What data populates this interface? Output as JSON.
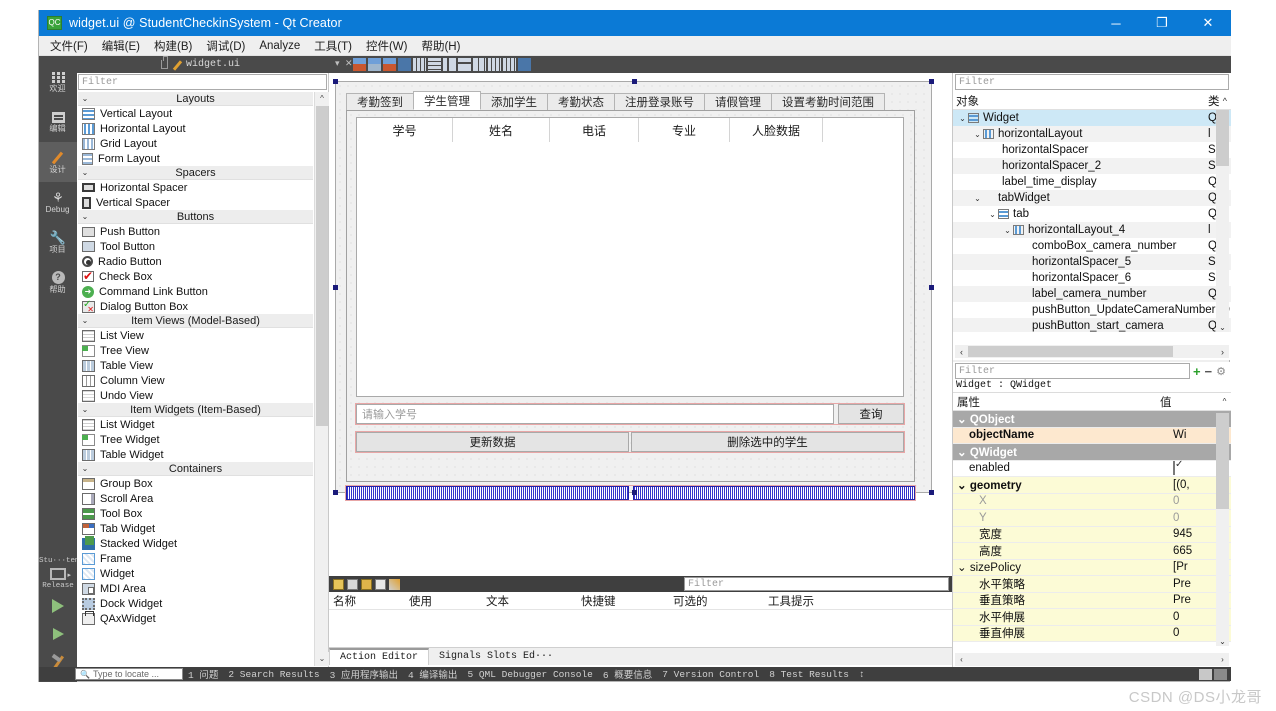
{
  "window": {
    "title": "widget.ui @ StudentCheckinSystem - Qt Creator",
    "app_icon": "qt-creator-icon",
    "minimize": "─",
    "maximize": "❐",
    "close": "✕"
  },
  "menubar": [
    {
      "label": "文件(F)"
    },
    {
      "label": "编辑(E)"
    },
    {
      "label": "构建(B)"
    },
    {
      "label": "调试(D)"
    },
    {
      "label": "Analyze"
    },
    {
      "label": "工具(T)"
    },
    {
      "label": "控件(W)"
    },
    {
      "label": "帮助(H)"
    }
  ],
  "modebar": {
    "items": [
      {
        "label": "欢迎",
        "icon": "grid-icon",
        "active": false
      },
      {
        "label": "编辑",
        "icon": "edit-icon",
        "active": false
      },
      {
        "label": "设计",
        "icon": "design-pencil-icon",
        "active": true
      },
      {
        "label": "Debug",
        "icon": "bug-icon",
        "active": false
      },
      {
        "label": "项目",
        "icon": "wrench-icon",
        "active": false
      },
      {
        "label": "帮助",
        "icon": "help-icon",
        "active": false
      }
    ],
    "kit_name": "Stu···tem",
    "kit_config": "Release",
    "run_icon": "run-icon",
    "debug_icon": "debug-run-icon",
    "build_icon": "build-hammer-icon"
  },
  "editor_toolbar": {
    "filename": "widget.ui",
    "lock_icon": "lock-icon",
    "file_icon": "ui-file-icon",
    "dropdown_icon": "chevron-down-icon",
    "close_icon": "close-icon",
    "form_tools": [
      "adjust-size-icon",
      "break-layout-icon",
      "lay-out-icon",
      "preview-icon",
      "lay-out-horizontally-icon",
      "lay-out-vertically-icon",
      "lay-out-splitter-h-icon",
      "lay-out-splitter-v-icon",
      "lay-out-form-icon",
      "lay-out-grid-icon",
      "signals-slots-icon",
      "buddy-editor-icon"
    ]
  },
  "widget_box": {
    "filter_placeholder": "Filter",
    "groups": [
      {
        "title": "Layouts",
        "items": [
          {
            "label": "Vertical Layout",
            "icon": "vertical-layout-icon"
          },
          {
            "label": "Horizontal Layout",
            "icon": "horizontal-layout-icon"
          },
          {
            "label": "Grid Layout",
            "icon": "grid-layout-icon"
          },
          {
            "label": "Form Layout",
            "icon": "form-layout-icon"
          }
        ]
      },
      {
        "title": "Spacers",
        "items": [
          {
            "label": "Horizontal Spacer",
            "icon": "horizontal-spacer-icon"
          },
          {
            "label": "Vertical Spacer",
            "icon": "vertical-spacer-icon"
          }
        ]
      },
      {
        "title": "Buttons",
        "items": [
          {
            "label": "Push Button",
            "icon": "push-button-icon"
          },
          {
            "label": "Tool Button",
            "icon": "tool-button-icon"
          },
          {
            "label": "Radio Button",
            "icon": "radio-button-icon"
          },
          {
            "label": "Check Box",
            "icon": "check-box-icon"
          },
          {
            "label": "Command Link Button",
            "icon": "command-link-button-icon"
          },
          {
            "label": "Dialog Button Box",
            "icon": "dialog-button-box-icon"
          }
        ]
      },
      {
        "title": "Item Views (Model-Based)",
        "items": [
          {
            "label": "List View",
            "icon": "list-view-icon"
          },
          {
            "label": "Tree View",
            "icon": "tree-view-icon"
          },
          {
            "label": "Table View",
            "icon": "table-view-icon"
          },
          {
            "label": "Column View",
            "icon": "column-view-icon"
          },
          {
            "label": "Undo View",
            "icon": "undo-view-icon"
          }
        ]
      },
      {
        "title": "Item Widgets (Item-Based)",
        "items": [
          {
            "label": "List Widget",
            "icon": "list-widget-icon"
          },
          {
            "label": "Tree Widget",
            "icon": "tree-widget-icon"
          },
          {
            "label": "Table Widget",
            "icon": "table-widget-icon"
          }
        ]
      },
      {
        "title": "Containers",
        "items": [
          {
            "label": "Group Box",
            "icon": "group-box-icon"
          },
          {
            "label": "Scroll Area",
            "icon": "scroll-area-icon"
          },
          {
            "label": "Tool Box",
            "icon": "tool-box-icon"
          },
          {
            "label": "Tab Widget",
            "icon": "tab-widget-icon"
          },
          {
            "label": "Stacked Widget",
            "icon": "stacked-widget-icon"
          },
          {
            "label": "Frame",
            "icon": "frame-icon"
          },
          {
            "label": "Widget",
            "icon": "widget-icon"
          },
          {
            "label": "MDI Area",
            "icon": "mdi-area-icon"
          },
          {
            "label": "Dock Widget",
            "icon": "dock-widget-icon"
          },
          {
            "label": "QAxWidget",
            "icon": "qaxwidget-icon"
          }
        ]
      }
    ]
  },
  "canvas": {
    "tabs": [
      {
        "label": "考勤签到",
        "selected": false
      },
      {
        "label": "学生管理",
        "selected": true
      },
      {
        "label": "添加学生",
        "selected": false
      },
      {
        "label": "考勤状态",
        "selected": false
      },
      {
        "label": "注册登录账号",
        "selected": false
      },
      {
        "label": "请假管理",
        "selected": false
      },
      {
        "label": "设置考勤时间范围",
        "selected": false
      }
    ],
    "table_headers": [
      "学号",
      "姓名",
      "电话",
      "专业",
      "人脸数据",
      ""
    ],
    "search_placeholder": "请输入学号",
    "search_button": "查询",
    "update_button": "更新数据",
    "delete_button": "删除选中的学生"
  },
  "action_editor": {
    "filter_placeholder": "Filter",
    "toolbar_icons": [
      "new-action-icon",
      "copy-icon",
      "paste-icon",
      "delete-icon",
      "edit-icon"
    ],
    "headers": [
      "名称",
      "使用",
      "文本",
      "快捷键",
      "可选的",
      "工具提示"
    ],
    "tabs": [
      {
        "label": "Action Editor",
        "selected": true
      },
      {
        "label": "Signals Slots Ed···",
        "selected": false
      }
    ]
  },
  "object_inspector": {
    "filter_placeholder": "Filter",
    "header_name": "对象",
    "header_class": "类",
    "rows": [
      {
        "name": "Widget",
        "cls": "Q",
        "indent": 0,
        "expander": "⌄",
        "icon": "widget-tree-icon",
        "selected": true
      },
      {
        "name": "horizontalLayout",
        "cls": "l",
        "indent": 1,
        "expander": "⌄",
        "icon": "hlayout-tree-icon",
        "selected": false
      },
      {
        "name": "horizontalSpacer",
        "cls": "S",
        "indent": 2,
        "expander": "",
        "icon": "",
        "selected": false
      },
      {
        "name": "horizontalSpacer_2",
        "cls": "S",
        "indent": 2,
        "expander": "",
        "icon": "",
        "selected": false
      },
      {
        "name": "label_time_display",
        "cls": "Q",
        "indent": 2,
        "expander": "",
        "icon": "",
        "selected": false
      },
      {
        "name": "tabWidget",
        "cls": "Q",
        "indent": 1,
        "expander": "⌄",
        "icon": "",
        "selected": false
      },
      {
        "name": "tab",
        "cls": "Q",
        "indent": 2,
        "expander": "⌄",
        "icon": "widget-tree-icon",
        "selected": false
      },
      {
        "name": "horizontalLayout_4",
        "cls": "l",
        "indent": 3,
        "expander": "⌄",
        "icon": "hlayout-tree-icon",
        "selected": false
      },
      {
        "name": "comboBox_camera_number",
        "cls": "Q",
        "indent": 4,
        "expander": "",
        "icon": "",
        "selected": false
      },
      {
        "name": "horizontalSpacer_5",
        "cls": "S",
        "indent": 4,
        "expander": "",
        "icon": "",
        "selected": false
      },
      {
        "name": "horizontalSpacer_6",
        "cls": "S",
        "indent": 4,
        "expander": "",
        "icon": "",
        "selected": false
      },
      {
        "name": "label_camera_number",
        "cls": "Q",
        "indent": 4,
        "expander": "",
        "icon": "",
        "selected": false
      },
      {
        "name": "pushButton_UpdateCameraNumber",
        "cls": "Q",
        "indent": 4,
        "expander": "",
        "icon": "",
        "selected": false
      },
      {
        "name": "pushButton_start_camera",
        "cls": "Q",
        "indent": 4,
        "expander": "",
        "icon": "",
        "selected": false
      }
    ]
  },
  "property_editor": {
    "filter_placeholder": "Filter",
    "tool_add": "+",
    "tool_remove": "−",
    "tool_config": "configure-icon",
    "object_line": "Widget : QWidget",
    "header_property": "属性",
    "header_value": "值",
    "rows": [
      {
        "name": "QObject",
        "value": "",
        "style": "group",
        "expander": "⌄",
        "indent": 0
      },
      {
        "name": "objectName",
        "value": "Wi",
        "style": "highlight",
        "expander": "",
        "indent": 1
      },
      {
        "name": "QWidget",
        "value": "",
        "style": "group",
        "expander": "⌄",
        "indent": 0
      },
      {
        "name": "enabled",
        "value": "checkbox",
        "style": "plain",
        "expander": "",
        "indent": 1
      },
      {
        "name": "geometry",
        "value": "[(0,",
        "style": "yellow-bold",
        "expander": "⌄",
        "indent": 0
      },
      {
        "name": "X",
        "value": "0",
        "style": "dim",
        "expander": "",
        "indent": 2
      },
      {
        "name": "Y",
        "value": "0",
        "style": "dim",
        "expander": "",
        "indent": 2
      },
      {
        "name": "宽度",
        "value": "945",
        "style": "yellow",
        "expander": "",
        "indent": 2
      },
      {
        "name": "高度",
        "value": "665",
        "style": "yellow",
        "expander": "",
        "indent": 2
      },
      {
        "name": "sizePolicy",
        "value": "[Pr",
        "style": "yellow",
        "expander": "⌄",
        "indent": 0
      },
      {
        "name": "水平策略",
        "value": "Pre",
        "style": "yellow",
        "expander": "",
        "indent": 2
      },
      {
        "name": "垂直策略",
        "value": "Pre",
        "style": "yellow",
        "expander": "",
        "indent": 2
      },
      {
        "name": "水平伸展",
        "value": "0",
        "style": "yellow",
        "expander": "",
        "indent": 2
      },
      {
        "name": "垂直伸展",
        "value": "0",
        "style": "yellow",
        "expander": "",
        "indent": 2
      }
    ]
  },
  "statusbar": {
    "locate_placeholder": "Type to locate ...",
    "search_icon": "search-icon",
    "items": [
      "1 问题",
      "2 Search Results",
      "3 应用程序输出",
      "4 编译输出",
      "5 QML Debugger Console",
      "6 概要信息",
      "7 Version Control",
      "8 Test Results"
    ],
    "updown": "↕"
  },
  "watermark": "CSDN @DS小龙哥"
}
